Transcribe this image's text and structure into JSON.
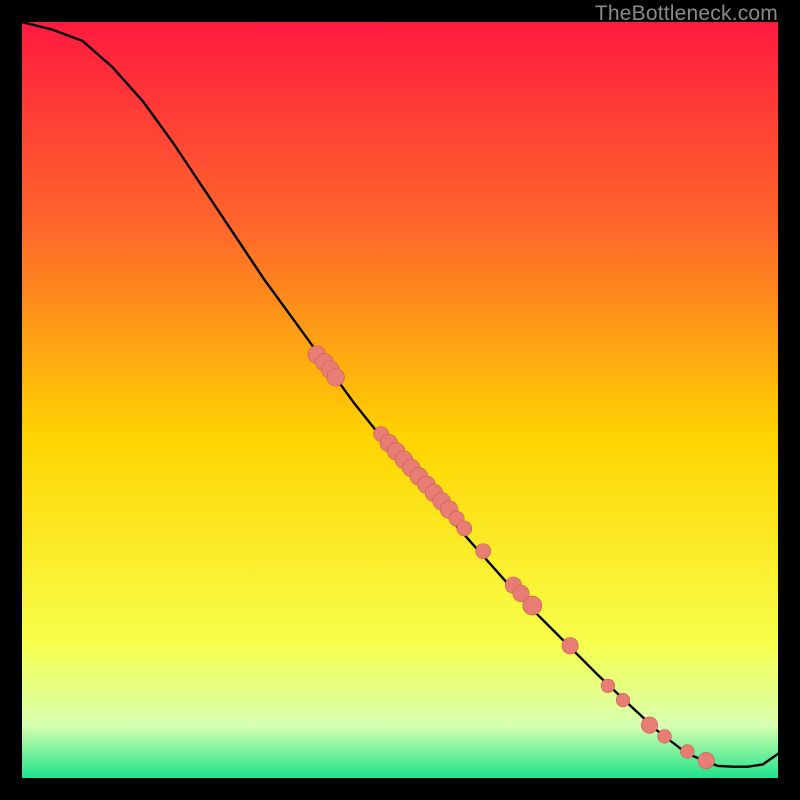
{
  "attribution": "TheBottleneck.com",
  "colors": {
    "frame": "#000000",
    "gradient_top": "#ff1a3f",
    "gradient_upper": "#ff6a2a",
    "gradient_mid": "#ffd400",
    "gradient_low1": "#f7ff4a",
    "gradient_low2": "#d7ffb0",
    "gradient_bottom": "#1fe28a",
    "curve": "#000000",
    "marker_fill": "#e77d74",
    "marker_stroke": "#cf5a52"
  },
  "chart_data": {
    "type": "line",
    "title": "",
    "xlabel": "",
    "ylabel": "",
    "xlim": [
      0,
      100
    ],
    "ylim": [
      0,
      100
    ],
    "series": [
      {
        "name": "curve",
        "x": [
          0,
          4,
          8,
          12,
          16,
          20,
          24,
          28,
          32,
          36,
          40,
          44,
          48,
          52,
          56,
          60,
          64,
          68,
          72,
          76,
          80,
          84,
          88,
          92,
          94,
          96,
          98,
          100
        ],
        "y": [
          100,
          99,
          97.5,
          94,
          89.5,
          84,
          78,
          72,
          66,
          60.5,
          55,
          49.5,
          44.5,
          39.8,
          35,
          30.5,
          26,
          21.8,
          17.8,
          13.8,
          10,
          6.3,
          3.2,
          1.6,
          1.5,
          1.5,
          1.8,
          3.2
        ]
      }
    ],
    "markers": [
      {
        "x": 39.0,
        "y": 56.0,
        "r": 1.3
      },
      {
        "x": 40.0,
        "y": 55.0,
        "r": 1.3
      },
      {
        "x": 40.8,
        "y": 54.0,
        "r": 1.3
      },
      {
        "x": 41.5,
        "y": 53.0,
        "r": 1.3
      },
      {
        "x": 47.5,
        "y": 45.5,
        "r": 1.1
      },
      {
        "x": 48.5,
        "y": 44.3,
        "r": 1.3
      },
      {
        "x": 49.5,
        "y": 43.2,
        "r": 1.3
      },
      {
        "x": 50.5,
        "y": 42.1,
        "r": 1.3
      },
      {
        "x": 51.5,
        "y": 41.0,
        "r": 1.3
      },
      {
        "x": 52.5,
        "y": 39.9,
        "r": 1.3
      },
      {
        "x": 53.5,
        "y": 38.8,
        "r": 1.3
      },
      {
        "x": 54.5,
        "y": 37.7,
        "r": 1.3
      },
      {
        "x": 55.5,
        "y": 36.6,
        "r": 1.3
      },
      {
        "x": 56.5,
        "y": 35.5,
        "r": 1.3
      },
      {
        "x": 57.5,
        "y": 34.3,
        "r": 1.1
      },
      {
        "x": 58.5,
        "y": 33.0,
        "r": 1.1
      },
      {
        "x": 61.0,
        "y": 30.0,
        "r": 1.1
      },
      {
        "x": 65.0,
        "y": 25.5,
        "r": 1.2
      },
      {
        "x": 66.0,
        "y": 24.4,
        "r": 1.2
      },
      {
        "x": 67.5,
        "y": 22.8,
        "r": 1.4
      },
      {
        "x": 72.5,
        "y": 17.5,
        "r": 1.2
      },
      {
        "x": 77.5,
        "y": 12.2,
        "r": 1.0
      },
      {
        "x": 79.5,
        "y": 10.3,
        "r": 1.0
      },
      {
        "x": 83.0,
        "y": 7.0,
        "r": 1.2
      },
      {
        "x": 85.0,
        "y": 5.5,
        "r": 1.0
      },
      {
        "x": 88.0,
        "y": 3.5,
        "r": 1.0
      },
      {
        "x": 90.5,
        "y": 2.3,
        "r": 1.2
      }
    ]
  }
}
